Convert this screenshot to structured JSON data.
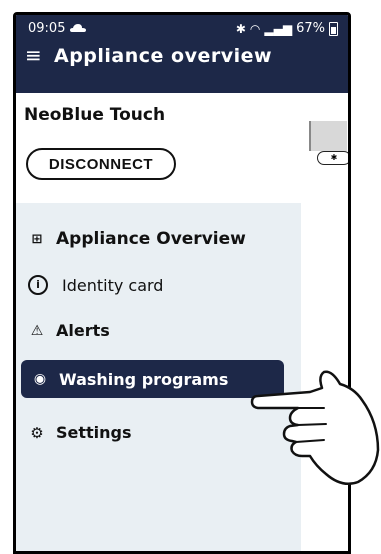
{
  "status_bar": {
    "time": "09:05",
    "battery": "67%",
    "icons": [
      "cloud-icon",
      "bluetooth-icon",
      "wifi-icon",
      "signal-icon",
      "battery-icon"
    ]
  },
  "app_bar": {
    "menu_icon": "menu-icon",
    "title": "Appliance overview"
  },
  "panel": {
    "device_name": "NeoBlue Touch",
    "disconnect_label": "DISCONNECT"
  },
  "nav": {
    "items": [
      {
        "label": "Appliance Overview",
        "icon": "grid-icon"
      },
      {
        "label": "Identity card",
        "icon": "info-icon"
      },
      {
        "label": "Alerts",
        "icon": "warning-icon"
      },
      {
        "label": "Washing programs",
        "icon": "washing-icon",
        "selected": true
      },
      {
        "label": "Settings",
        "icon": "gear-icon"
      }
    ]
  },
  "colors": {
    "primary": "#1d2848",
    "nav_background": "#e9eff3",
    "text": "#111111"
  }
}
